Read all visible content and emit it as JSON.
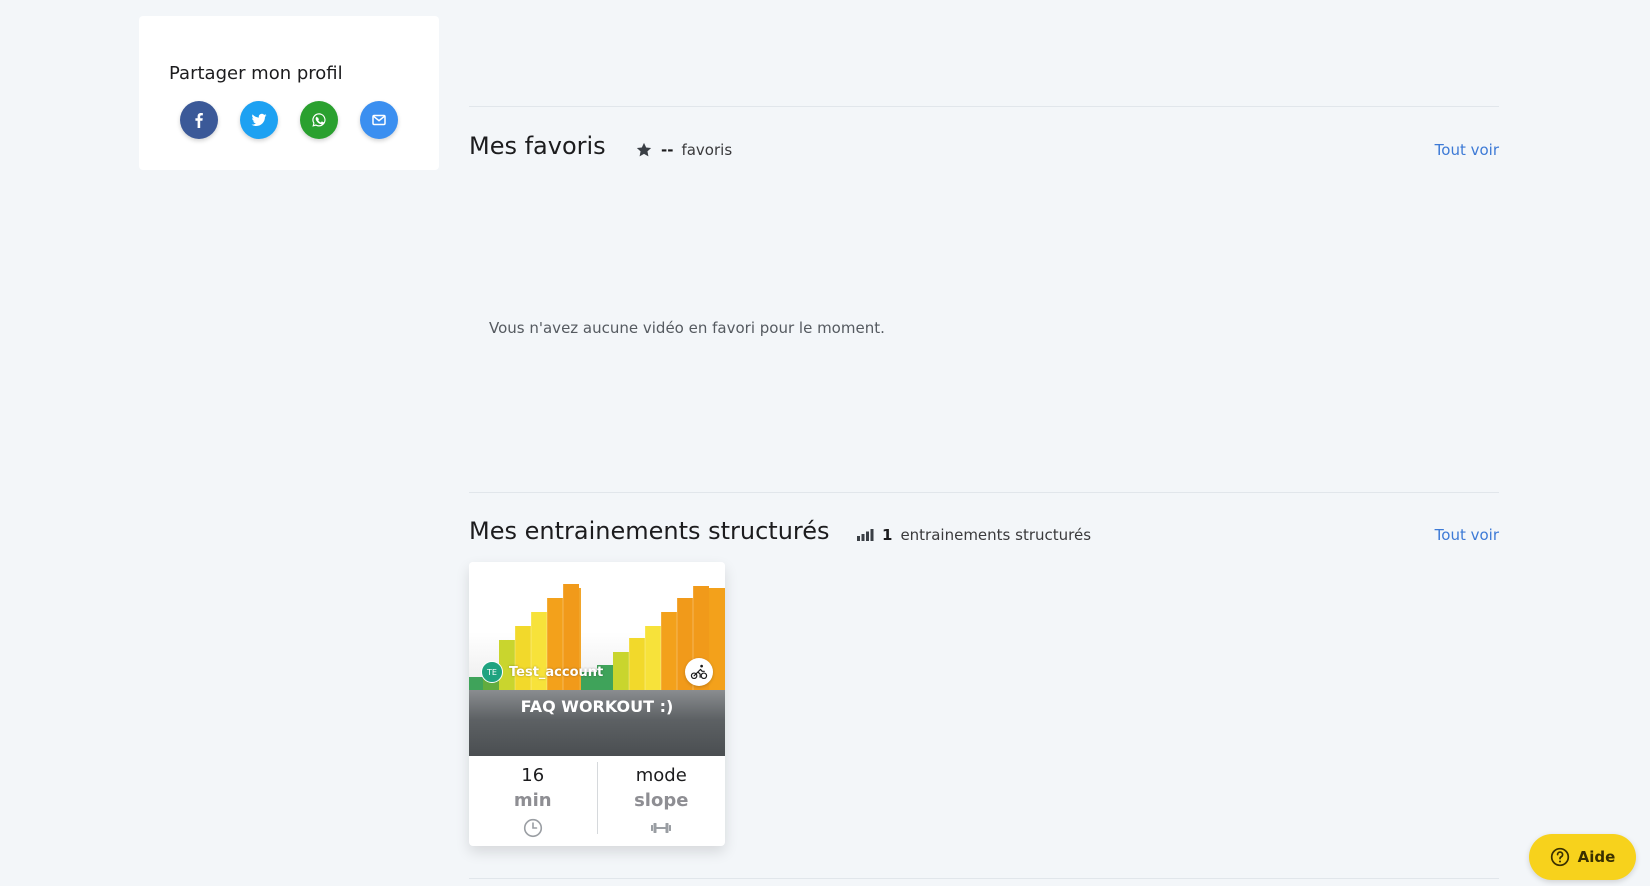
{
  "share": {
    "title": "Partager mon profil",
    "buttons": [
      {
        "name": "facebook",
        "color": "#3b5998"
      },
      {
        "name": "twitter",
        "color": "#1da1f2"
      },
      {
        "name": "whatsapp",
        "color": "#2aa02f"
      },
      {
        "name": "email",
        "color": "#3b8ff0"
      }
    ]
  },
  "favorites": {
    "title": "Mes favoris",
    "count": "--",
    "count_label": "favoris",
    "see_all": "Tout voir",
    "empty_message": "Vous n'avez aucune vidéo en favori pour le moment."
  },
  "workouts": {
    "title": "Mes entrainements structurés",
    "count": "1",
    "count_label": "entrainements structurés",
    "see_all": "Tout voir",
    "items": [
      {
        "title": "FAQ WORKOUT :)",
        "author": "Test_account",
        "author_initials": "TE",
        "sport_icon": "cycling-icon",
        "duration_value": "16",
        "duration_unit": "min",
        "mode_value": "mode",
        "mode_unit": "slope"
      }
    ]
  },
  "help": {
    "label": "Aide"
  },
  "colors": {
    "accent_link": "#3d7ad6",
    "help_yellow": "#f7d21c",
    "zone_green": "#3fa35a",
    "zone_lime": "#b8d432",
    "zone_yellow": "#f5dd2a",
    "zone_orange": "#f19a1a"
  }
}
